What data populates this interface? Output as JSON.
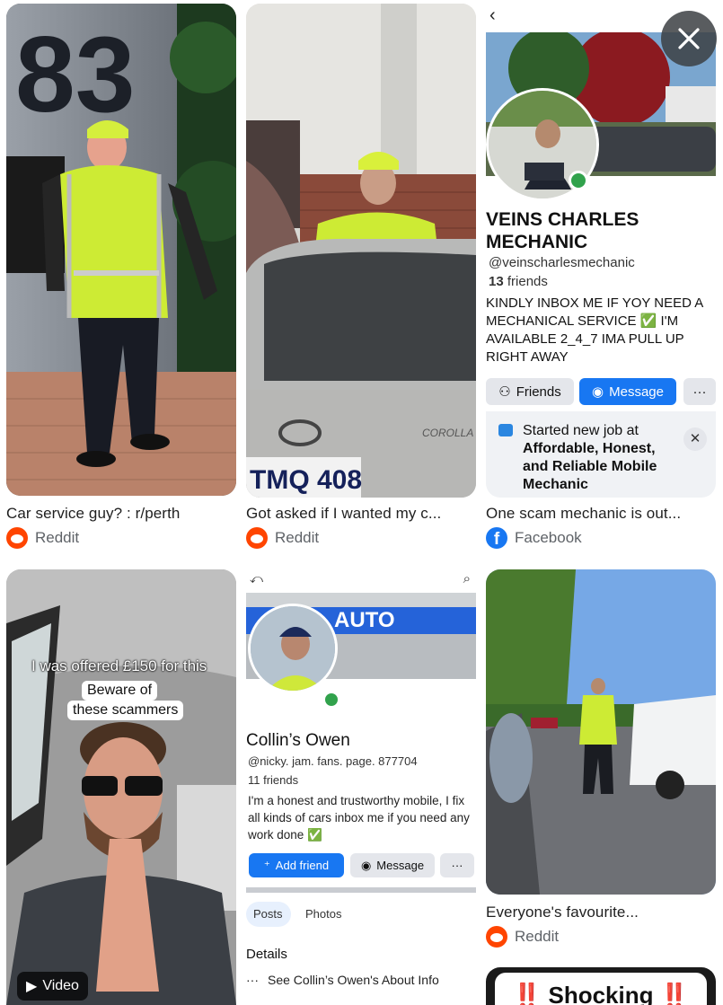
{
  "cards": [
    {
      "title": "Car service guy? : r/perth",
      "source": "Reddit"
    },
    {
      "title": "Got asked if I wanted my c...",
      "source": "Reddit"
    },
    {
      "title": "One scam mechanic is out...",
      "source": "Facebook"
    },
    {
      "video_label": "Video",
      "tt_line1": "I was offered £150 for this",
      "tt_line2": "Beware of",
      "tt_line3": "these scammers"
    },
    {
      "profile_banner": "AUTO SERVIC",
      "profile_name": "Collin’s Owen",
      "profile_handle": "@nicky. jam. fans. page. 877704",
      "profile_friends": "11 friends",
      "profile_bio": "I'm a honest and trustworthy mobile, I fix all kinds of cars inbox me if you need any work done ✅",
      "add_friend": "Add friend",
      "message": "Message",
      "more": "···",
      "tab_posts": "Posts",
      "tab_photos": "Photos",
      "details": "Details",
      "see_about": "See Collin’s Owen's About Info"
    },
    {
      "title": "Everyone's favourite...",
      "source": "Reddit"
    },
    {
      "teaser": "‼️ Shocking ‼️"
    }
  ],
  "profile3": {
    "name_line1": "VEINS CHARLES",
    "name_line2": "MECHANIC",
    "handle": "@veinscharlesmechanic",
    "friends_count": "13",
    "friends_word": "friends",
    "bio": "KINDLY INBOX ME IF YOY NEED A MECHANICAL SERVICE ✅ I'M AVAILABLE 2_4_7 IMA PULL UP RIGHT AWAY",
    "friends_btn": "Friends",
    "message_btn": "Message",
    "more_btn": "···",
    "job_line1": "Started new job at",
    "job_line2": "Affordable, Honest,",
    "job_line3": "and Reliable Mobile",
    "job_line4": "Mechanic"
  },
  "plate": "TMQ 408",
  "car_model": "COROLLA",
  "building_number": "83",
  "colors": {
    "facebook_blue": "#1877f2",
    "reddit_orange": "#ff4500",
    "hi_vis": "#c9f03a"
  }
}
